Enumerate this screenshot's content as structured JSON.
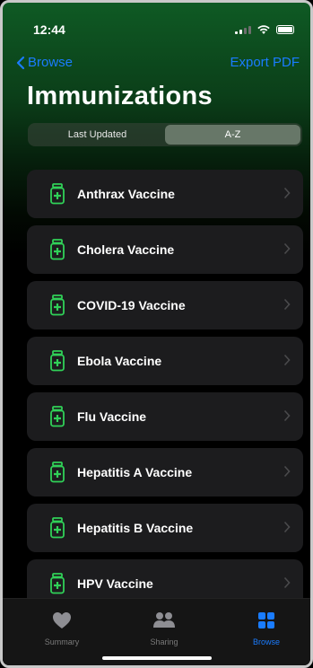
{
  "status": {
    "time": "12:44"
  },
  "nav": {
    "back_label": "Browse",
    "action_label": "Export PDF"
  },
  "page": {
    "title": "Immunizations"
  },
  "segmented": {
    "options": [
      "Last Updated",
      "A-Z"
    ],
    "selected": "A-Z"
  },
  "list": {
    "items": [
      {
        "label": "Anthrax Vaccine"
      },
      {
        "label": "Cholera Vaccine"
      },
      {
        "label": "COVID-19 Vaccine"
      },
      {
        "label": "Ebola Vaccine"
      },
      {
        "label": "Flu Vaccine"
      },
      {
        "label": "Hepatitis A Vaccine"
      },
      {
        "label": "Hepatitis B Vaccine"
      },
      {
        "label": "HPV Vaccine"
      }
    ]
  },
  "tabbar": {
    "tabs": [
      {
        "label": "Summary",
        "icon": "heart-icon"
      },
      {
        "label": "Sharing",
        "icon": "people-icon"
      },
      {
        "label": "Browse",
        "icon": "grid-icon"
      }
    ],
    "selected": "Browse"
  },
  "colors": {
    "accent": "#1a7cff",
    "vaccine_icon": "#30d158",
    "row_bg": "#1c1c1e"
  }
}
